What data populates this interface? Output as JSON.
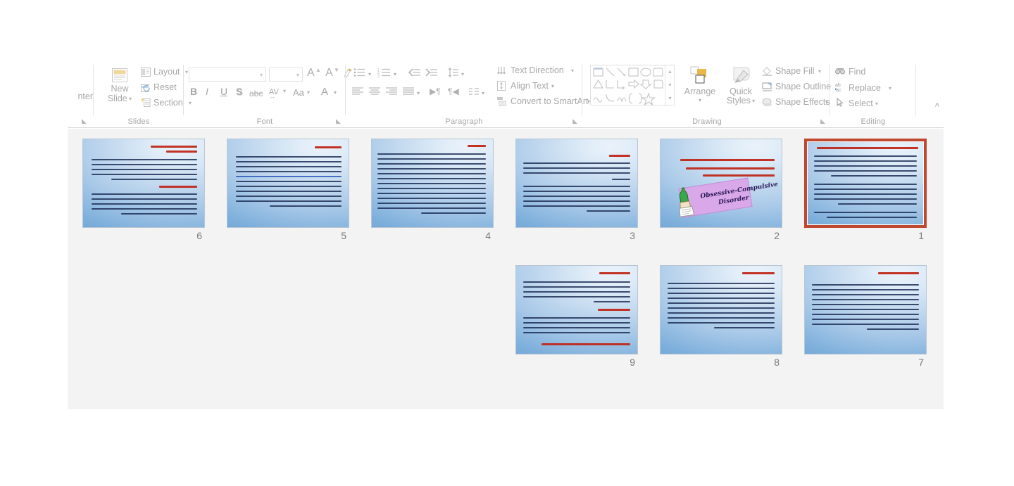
{
  "app": {
    "name": "PowerPoint Slide Sorter",
    "accent_selection_color": "#c0482e",
    "ribbon_label_color": "#a6a6a6",
    "workspace_bg": "#f3f3f3"
  },
  "ribbon": {
    "groups": [
      {
        "name": "clipboard",
        "label": "",
        "truncated_label": "nter"
      },
      {
        "name": "slides",
        "label": "Slides"
      },
      {
        "name": "font",
        "label": "Font"
      },
      {
        "name": "paragraph",
        "label": "Paragraph"
      },
      {
        "name": "drawing",
        "label": "Drawing"
      },
      {
        "name": "editing",
        "label": "Editing"
      }
    ],
    "clipboard": {
      "format_painter_truncated": "nter"
    },
    "slides": {
      "new_slide_line1": "New",
      "new_slide_line2": "Slide",
      "layout": "Layout",
      "reset": "Reset",
      "section": "Section"
    },
    "font": {
      "font_name_value": "",
      "font_name_placeholder": "",
      "font_size_value": "",
      "font_size_placeholder": "",
      "increase_font_size": "A",
      "decrease_font_size": "A",
      "clear_formatting": "clear-formatting",
      "bold": "B",
      "italic": "I",
      "underline": "U",
      "shadow": "S",
      "strikethrough": "abc",
      "character_spacing": "AV",
      "change_case": "Aa",
      "font_color": "A"
    },
    "paragraph": {
      "text_direction": "Text Direction",
      "align_text": "Align Text",
      "convert_to_smartart": "Convert to SmartArt"
    },
    "drawing": {
      "arrange": "Arrange",
      "quick_styles_line1": "Quick",
      "quick_styles_line2": "Styles",
      "shape_fill": "Shape Fill",
      "shape_outline": "Shape Outline",
      "shape_effects": "Shape Effects"
    },
    "editing": {
      "find": "Find",
      "replace": "Replace",
      "select": "Select"
    },
    "collapse_ribbon": "collapse-ribbon"
  },
  "slide_sorter": {
    "selected_slide": 1,
    "slides": [
      {
        "number": "6",
        "row": 0,
        "col": 0,
        "selected": false,
        "has_clipart": false,
        "title_color": "#c0281a"
      },
      {
        "number": "5",
        "row": 0,
        "col": 1,
        "selected": false,
        "has_clipart": false,
        "title_color": "#c0281a"
      },
      {
        "number": "4",
        "row": 0,
        "col": 2,
        "selected": false,
        "has_clipart": false,
        "title_color": "#c0281a"
      },
      {
        "number": "3",
        "row": 0,
        "col": 3,
        "selected": false,
        "has_clipart": false,
        "title_color": "#c0281a"
      },
      {
        "number": "2",
        "row": 0,
        "col": 4,
        "selected": false,
        "has_clipart": true,
        "clipart_caption_line1": "Obsessive-Compulsive",
        "clipart_caption_line2": "Disorder",
        "clipart_bg": "#d9a8e8",
        "title_color": "#c0281a"
      },
      {
        "number": "1",
        "row": 0,
        "col": 5,
        "selected": true,
        "has_clipart": false,
        "title_color": "#c0281a"
      },
      {
        "number": "9",
        "row": 1,
        "col": 3,
        "selected": false,
        "has_clipart": false,
        "title_color": "#c0281a"
      },
      {
        "number": "8",
        "row": 1,
        "col": 4,
        "selected": false,
        "has_clipart": false,
        "title_color": "#c0281a"
      },
      {
        "number": "7",
        "row": 1,
        "col": 5,
        "selected": false,
        "has_clipart": false,
        "title_color": "#c0281a"
      }
    ]
  }
}
